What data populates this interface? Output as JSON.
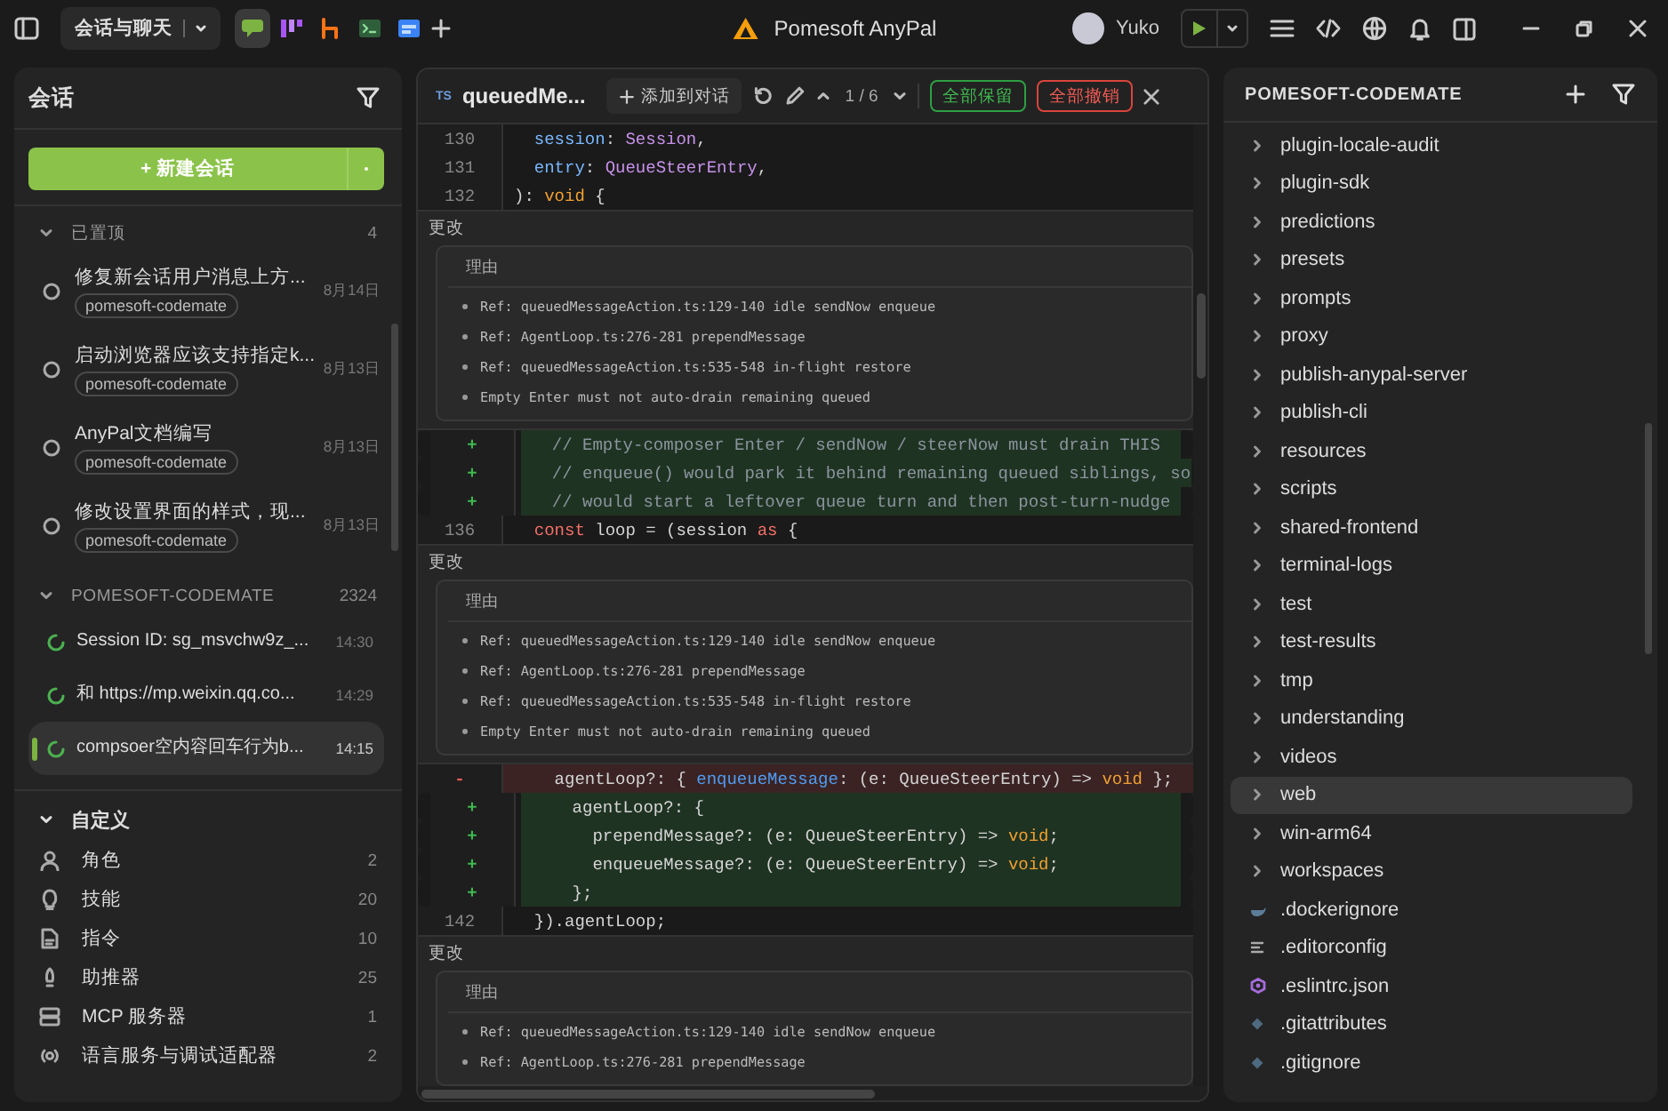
{
  "titlebar": {
    "workspace": "会话与聊天",
    "apps": [
      {
        "kind": "chat",
        "selected": true
      },
      {
        "kind": "board",
        "selected": false
      },
      {
        "kind": "branch",
        "selected": false
      },
      {
        "kind": "terminal",
        "selected": false
      },
      {
        "kind": "browser",
        "selected": false
      }
    ],
    "app_title": "Pomesoft AnyPal",
    "user": "Yuko"
  },
  "sessions_panel": {
    "title": "会话",
    "new_button": "+ 新建会话",
    "groups": [
      {
        "kind": "pinned",
        "title": "已置顶",
        "count": "4",
        "expanded": true,
        "items": [
          {
            "title": "修复新会话用户消息上方...",
            "tag": "pomesoft-codemate",
            "time": "8月14日",
            "selected": false
          },
          {
            "title": "启动浏览器应该支持指定k...",
            "tag": "pomesoft-codemate",
            "time": "8月13日",
            "selected": false
          },
          {
            "title": "AnyPal文档编写",
            "tag": "pomesoft-codemate",
            "time": "8月13日",
            "selected": false
          },
          {
            "title": "修改设置界面的样式，现...",
            "tag": "pomesoft-codemate",
            "time": "8月13日",
            "selected": false
          }
        ]
      },
      {
        "kind": "running",
        "title": "POMESOFT-CODEMATE",
        "count": "2324",
        "expanded": true,
        "items": [
          {
            "title": "Session ID: sg_msvchw9z_...",
            "time": "14:30",
            "selected": false
          },
          {
            "title": "和 https://mp.weixin.qq.co...",
            "time": "14:29",
            "selected": false
          },
          {
            "title": "compsoer空内容回车行为b...",
            "time": "14:15",
            "selected": true
          }
        ]
      }
    ],
    "custom": {
      "title": "自定义",
      "expanded": true,
      "items": [
        {
          "kind": "role",
          "label": "角色",
          "count": "2"
        },
        {
          "kind": "skill",
          "label": "技能",
          "count": "20"
        },
        {
          "kind": "command",
          "label": "指令",
          "count": "10"
        },
        {
          "kind": "booster",
          "label": "助推器",
          "count": "25"
        },
        {
          "kind": "server",
          "label": "MCP 服务器",
          "count": "1"
        },
        {
          "kind": "adapter",
          "label": "语言服务与调试适配器",
          "count": "2"
        }
      ]
    }
  },
  "diff": {
    "file_badge": "TS",
    "file": "queuedMe...",
    "add_button": "添加到对话",
    "position": "1 / 6",
    "keep_all": "全部保留",
    "discard_all": "全部撤销",
    "blocks": [
      {
        "kind": "code",
        "lines": [
          {
            "gutter": "130",
            "kind": "context",
            "parts": [
              {
                "text": "  session",
                "kind": "prop"
              },
              {
                "text": ": ",
                "kind": "plain"
              },
              {
                "text": "Session",
                "kind": "type"
              },
              {
                "text": ",",
                "kind": "plain"
              }
            ]
          },
          {
            "gutter": "131",
            "kind": "context",
            "parts": [
              {
                "text": "  entry",
                "kind": "prop"
              },
              {
                "text": ": ",
                "kind": "plain"
              },
              {
                "text": "QueueSteerEntry",
                "kind": "type"
              },
              {
                "text": ",",
                "kind": "plain"
              }
            ]
          },
          {
            "gutter": "132",
            "kind": "context",
            "parts": [
              {
                "text": "): ",
                "kind": "plain"
              },
              {
                "text": "void",
                "kind": "keyword"
              },
              {
                "text": " {",
                "kind": "plain"
              }
            ]
          }
        ]
      },
      {
        "kind": "change",
        "label": "更改",
        "reason_title": "理由",
        "bullets": [
          "Ref: queuedMessageAction.ts:129-140 idle sendNow enqueue",
          "Ref: AgentLoop.ts:276-281 prependMessage",
          "Ref: queuedMessageAction.ts:535-548 in-flight restore",
          "Empty Enter must not auto-drain remaining queued"
        ]
      },
      {
        "kind": "code",
        "lines": [
          {
            "gutter": "+",
            "kind": "add",
            "parts": [
              {
                "text": "  // Empty-composer Enter / sendNow / steerNow must drain THIS",
                "kind": "comment"
              }
            ]
          },
          {
            "gutter": "+",
            "kind": "add",
            "parts": [
              {
                "text": "  // enqueue() would park it behind remaining queued siblings, so",
                "kind": "comment"
              }
            ]
          },
          {
            "gutter": "+",
            "kind": "add",
            "parts": [
              {
                "text": "  // would start a leftover queue turn and then post-turn-nudge",
                "kind": "comment"
              }
            ]
          },
          {
            "gutter": "136",
            "kind": "context",
            "parts": [
              {
                "text": "  const",
                "kind": "control"
              },
              {
                "text": " loop = (session ",
                "kind": "plain"
              },
              {
                "text": "as",
                "kind": "control"
              },
              {
                "text": " {",
                "kind": "plain"
              }
            ]
          }
        ]
      },
      {
        "kind": "change",
        "label": "更改",
        "reason_title": "理由",
        "bullets": [
          "Ref: queuedMessageAction.ts:129-140 idle sendNow enqueue",
          "Ref: AgentLoop.ts:276-281 prependMessage",
          "Ref: queuedMessageAction.ts:535-548 in-flight restore",
          "Empty Enter must not auto-drain remaining queued"
        ]
      },
      {
        "kind": "code",
        "lines": [
          {
            "gutter": "-",
            "kind": "remove",
            "parts": [
              {
                "text": "    agentLoop?: { ",
                "kind": "plain"
              },
              {
                "text": "enqueueMessage",
                "kind": "method"
              },
              {
                "text": ": (e: QueueSteerEntry) => ",
                "kind": "plain"
              },
              {
                "text": "void",
                "kind": "keyword"
              },
              {
                "text": " };",
                "kind": "plain"
              }
            ]
          },
          {
            "gutter": "+",
            "kind": "add",
            "parts": [
              {
                "text": "    agentLoop?: {",
                "kind": "plain"
              }
            ]
          },
          {
            "gutter": "+",
            "kind": "add",
            "parts": [
              {
                "text": "      prependMessage?: (e: QueueSteerEntry) => ",
                "kind": "plain"
              },
              {
                "text": "void",
                "kind": "keyword"
              },
              {
                "text": ";",
                "kind": "plain"
              }
            ]
          },
          {
            "gutter": "+",
            "kind": "add",
            "parts": [
              {
                "text": "      enqueueMessage?: (e: QueueSteerEntry) => ",
                "kind": "plain"
              },
              {
                "text": "void",
                "kind": "keyword"
              },
              {
                "text": ";",
                "kind": "plain"
              }
            ]
          },
          {
            "gutter": "+",
            "kind": "add",
            "parts": [
              {
                "text": "    };",
                "kind": "plain"
              }
            ]
          },
          {
            "gutter": "142",
            "kind": "context",
            "parts": [
              {
                "text": "  }).agentLoop;",
                "kind": "plain"
              }
            ]
          }
        ]
      },
      {
        "kind": "change",
        "label": "更改",
        "reason_title": "理由",
        "bullets": [
          "Ref: queuedMessageAction.ts:129-140 idle sendNow enqueue",
          "Ref: AgentLoop.ts:276-281 prependMessage"
        ]
      }
    ]
  },
  "files": {
    "title": "POMESOFT-CODEMATE",
    "items": [
      {
        "name": "plugin-locale-audit",
        "kind": "folder",
        "selected": false
      },
      {
        "name": "plugin-sdk",
        "kind": "folder",
        "selected": false
      },
      {
        "name": "predictions",
        "kind": "folder",
        "selected": false
      },
      {
        "name": "presets",
        "kind": "folder",
        "selected": false
      },
      {
        "name": "prompts",
        "kind": "folder",
        "selected": false
      },
      {
        "name": "proxy",
        "kind": "folder",
        "selected": false
      },
      {
        "name": "publish-anypal-server",
        "kind": "folder",
        "selected": false
      },
      {
        "name": "publish-cli",
        "kind": "folder",
        "selected": false
      },
      {
        "name": "resources",
        "kind": "folder",
        "selected": false
      },
      {
        "name": "scripts",
        "kind": "folder",
        "selected": false
      },
      {
        "name": "shared-frontend",
        "kind": "folder",
        "selected": false
      },
      {
        "name": "terminal-logs",
        "kind": "folder",
        "selected": false
      },
      {
        "name": "test",
        "kind": "folder",
        "selected": false
      },
      {
        "name": "test-results",
        "kind": "folder",
        "selected": false
      },
      {
        "name": "tmp",
        "kind": "folder",
        "selected": false
      },
      {
        "name": "understanding",
        "kind": "folder",
        "selected": false
      },
      {
        "name": "videos",
        "kind": "folder",
        "selected": false
      },
      {
        "name": "web",
        "kind": "folder",
        "selected": true
      },
      {
        "name": "win-arm64",
        "kind": "folder",
        "selected": false
      },
      {
        "name": "workspaces",
        "kind": "folder",
        "selected": false
      },
      {
        "name": ".dockerignore",
        "kind": "docker",
        "selected": false
      },
      {
        "name": ".editorconfig",
        "kind": "config",
        "selected": false
      },
      {
        "name": ".eslintrc.json",
        "kind": "eslint",
        "selected": false
      },
      {
        "name": ".gitattributes",
        "kind": "git",
        "selected": false
      },
      {
        "name": ".gitignore",
        "kind": "git",
        "selected": false
      }
    ]
  }
}
